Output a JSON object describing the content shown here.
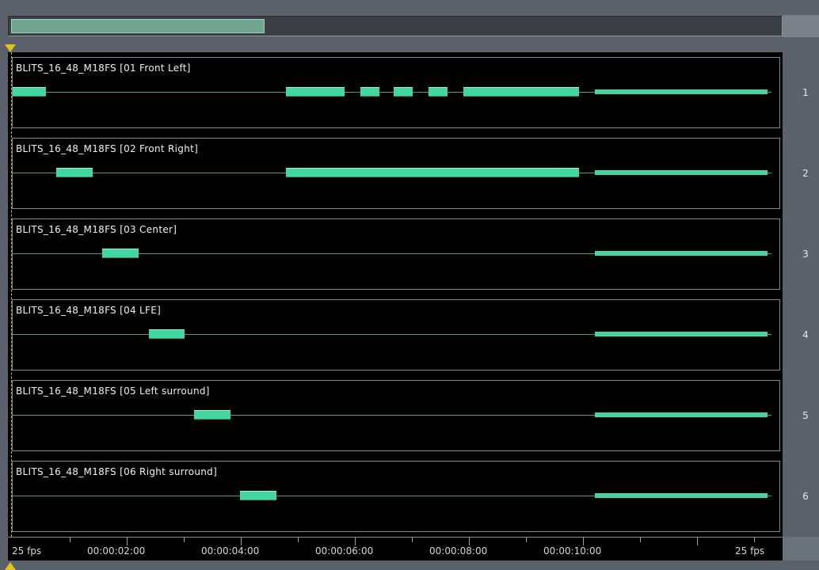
{
  "scrollbar": {
    "position_fraction": 0.0,
    "thumb_fraction": 0.33
  },
  "tracks": [
    {
      "number": "1",
      "title": "BLITS_16_48_M18FS [01 Front Left]"
    },
    {
      "number": "2",
      "title": "BLITS_16_48_M18FS [02 Front Right]"
    },
    {
      "number": "3",
      "title": "BLITS_16_48_M18FS [03 Center]"
    },
    {
      "number": "4",
      "title": "BLITS_16_48_M18FS [04 LFE]"
    },
    {
      "number": "5",
      "title": "BLITS_16_48_M18FS [05 Left surround]"
    },
    {
      "number": "6",
      "title": "BLITS_16_48_M18FS [06 Right surround]"
    }
  ],
  "ruler": {
    "fps_left": "25 fps",
    "fps_right": "25 fps",
    "timecodes": [
      "00:00:02:00",
      "00:00:04:00",
      "00:00:06:00",
      "00:00:08:00",
      "00:00:10:00"
    ]
  },
  "colors": {
    "clip": "#3fd8a0",
    "playhead": "#e2c21a",
    "background": "#000000"
  }
}
